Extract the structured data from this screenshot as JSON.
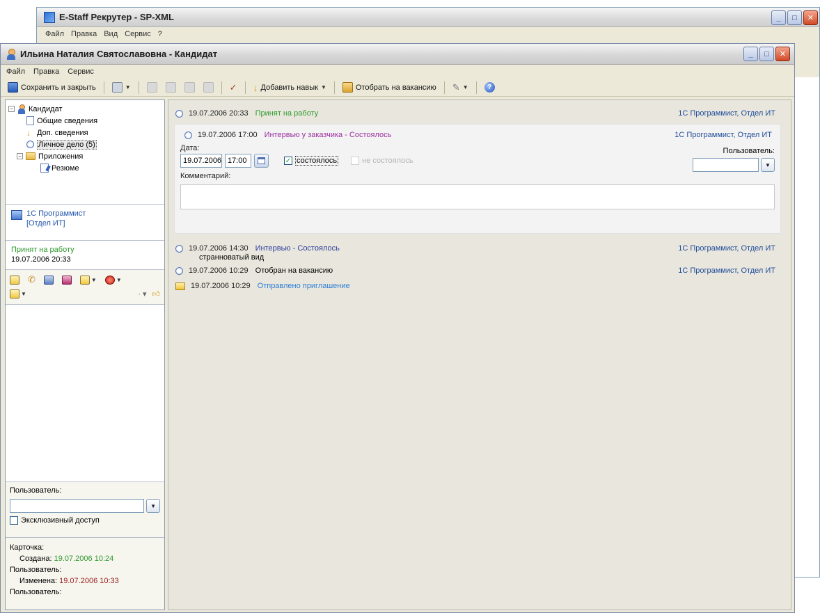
{
  "background_window": {
    "title": "E-Staff Рекрутер - SP-XML",
    "menu": [
      "Файл",
      "Правка",
      "Вид",
      "Сервис",
      "?"
    ]
  },
  "window": {
    "title": "Ильина Наталия Святославовна - Кандидат",
    "menu": [
      "Файл",
      "Правка",
      "Сервис"
    ]
  },
  "toolbar": {
    "save_close": "Сохранить и закрыть",
    "add_skill": "Добавить навык",
    "select_vacancy": "Отобрать на вакансию"
  },
  "tree": {
    "root": "Кандидат",
    "items": [
      "Общие сведения",
      "Доп. сведения",
      "Личное дело (5)",
      "Приложения",
      "Резюме"
    ]
  },
  "vacancy": {
    "name": "1С Программист",
    "dept": "[Отдел ИТ]"
  },
  "status": {
    "text": "Принят на работу",
    "date": "19.07.2006 20:33"
  },
  "user_box": {
    "label": "Пользователь:",
    "exclusive": "Эксклюзивный доступ"
  },
  "card": {
    "label": "Карточка:",
    "created_label": "Создана:",
    "created_value": "19.07.2006 10:24",
    "user_label_1": "Пользователь:",
    "modified_label": "Изменена:",
    "modified_value": "19.07.2006 10:33",
    "user_label_2": "Пользователь:"
  },
  "events": [
    {
      "date": "19.07.2006 20:33",
      "type": "Принят на работу",
      "target": "1С Программист,  Отдел ИТ"
    },
    {
      "date": "19.07.2006 17:00",
      "type": "Интервью у заказчика  -  Состоялось",
      "target": "1С Программист,  Отдел ИТ"
    },
    {
      "date": "19.07.2006 14:30",
      "type": "Интервью  -  Состоялось",
      "target": "1С Программист,  Отдел ИТ",
      "comment": "странноватый вид"
    },
    {
      "date": "19.07.2006 10:29",
      "type": "Отобран на вакансию",
      "target": "1С Программист,  Отдел ИТ"
    },
    {
      "date": "19.07.2006 10:29",
      "type": "Отправлено приглашение",
      "target": ""
    }
  ],
  "edit": {
    "date_label": "Дата:",
    "date": "19.07.2006",
    "time": "17:00",
    "occurred": "состоялось",
    "not_occurred": "не состоялось",
    "user_label": "Пользователь:",
    "comment_label": "Комментарий:"
  },
  "colors": {
    "status_green": "#2f9a2f",
    "interview_purple": "#9b2ca0",
    "invite_blue": "#2e7ed6",
    "vacancy_link": "#1f4b99"
  }
}
